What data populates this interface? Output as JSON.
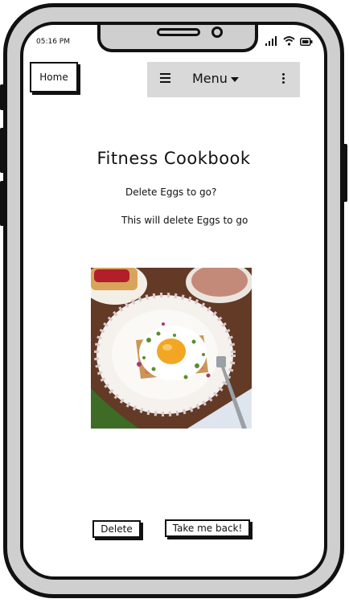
{
  "status_bar": {
    "time": "05:16 PM",
    "icons": [
      "signal-icon",
      "wifi-icon",
      "battery-icon"
    ]
  },
  "nav": {
    "home_label": "Home",
    "menu_label": "Menu",
    "menu_icon": "hamburger-icon",
    "dropdown_icon": "caret-down-icon",
    "more_icon": "kebab-icon"
  },
  "page": {
    "title": "Fitness Cookbook",
    "question": "Delete Eggs to go?",
    "description": "This will delete Eggs to go",
    "image_subject": "fried egg on toast breakfast plate"
  },
  "actions": {
    "delete_label": "Delete",
    "back_label": "Take me back!"
  },
  "colors": {
    "menubar_bg": "#d9d9d9",
    "phone_frame": "#cfcfcf"
  }
}
